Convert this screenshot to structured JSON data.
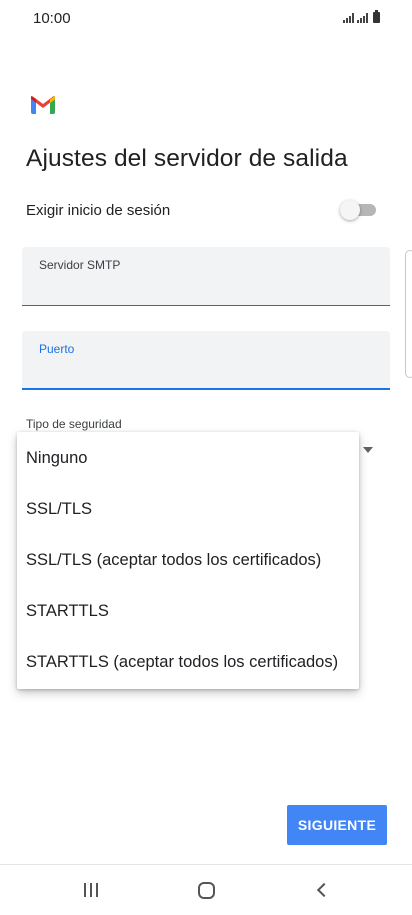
{
  "status_bar": {
    "time": "10:00",
    "icons": [
      "signal-icon",
      "signal-icon",
      "battery-icon"
    ]
  },
  "app": {
    "logo": "gmail-logo",
    "logo_colors": [
      "#ea4335",
      "#fbbc04",
      "#34a853",
      "#4285f4",
      "#c5221f"
    ]
  },
  "page": {
    "title": "Ajustes del servidor de salida"
  },
  "require_login": {
    "label": "Exigir inicio de sesión",
    "enabled": false
  },
  "fields": {
    "smtp": {
      "label": "Servidor SMTP",
      "value": ""
    },
    "port": {
      "label": "Puerto",
      "value": "",
      "focused": true
    }
  },
  "security": {
    "label": "Tipo de seguridad",
    "options": [
      "Ninguno",
      "SSL/TLS",
      "SSL/TLS (aceptar todos los certificados)",
      "STARTTLS",
      "STARTTLS (aceptar todos los certificados)"
    ]
  },
  "actions": {
    "next_label": "SIGUIENTE"
  },
  "nav": {
    "items": [
      "recent-apps-icon",
      "home-icon",
      "back-icon"
    ]
  },
  "colors": {
    "accent": "#1a73e8",
    "button": "#4285f4",
    "field_bg": "#f1f3f4"
  }
}
